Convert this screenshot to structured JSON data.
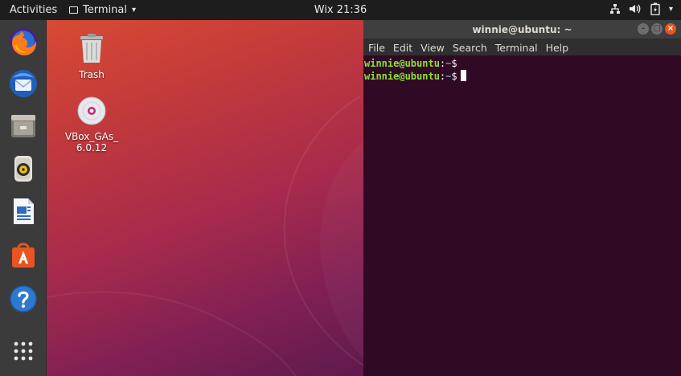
{
  "topbar": {
    "activities": "Activities",
    "app_name": "Terminal",
    "app_menu_arrow": "▾",
    "clock": "Wix 21:36",
    "tray_icons": [
      "network-icon",
      "volume-icon",
      "battery-icon",
      "system-menu-arrow-icon"
    ]
  },
  "dock": {
    "items": [
      "firefox-icon",
      "thunderbird-icon",
      "files-icon",
      "rhythmbox-icon",
      "libreoffice-writer-icon",
      "software-center-icon",
      "help-icon",
      "show-applications-icon"
    ]
  },
  "desktop": {
    "icons": [
      {
        "label": "Trash",
        "icon": "trash-icon"
      },
      {
        "label": "VBox_GAs_\n6.0.12",
        "label_line1": "VBox_GAs_",
        "label_line2": "6.0.12",
        "icon": "optical-disc-icon"
      }
    ]
  },
  "terminal": {
    "title": "winnie@ubuntu: ~",
    "buttons": {
      "minimize": "–",
      "maximize": "□",
      "close": "×"
    },
    "menu": [
      "File",
      "Edit",
      "View",
      "Search",
      "Terminal",
      "Help"
    ],
    "lines": [
      {
        "user": "winnie@ubuntu",
        "sep": ":",
        "path": "~",
        "prompt": "$"
      },
      {
        "user": "winnie@ubuntu",
        "sep": ":",
        "path": "~",
        "prompt": "$"
      }
    ]
  },
  "colors": {
    "accent": "#e95420",
    "terminal_bg": "#300a24",
    "prompt_user": "#8ae234",
    "prompt_path": "#729fcf"
  }
}
